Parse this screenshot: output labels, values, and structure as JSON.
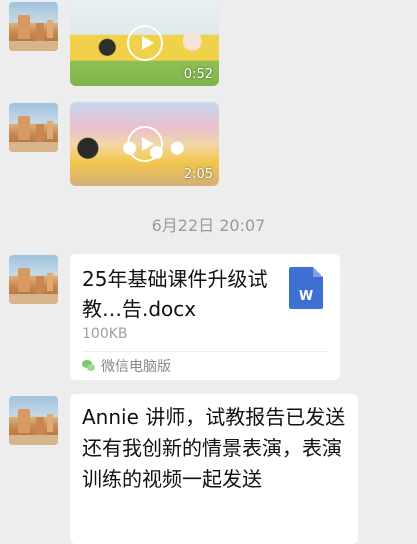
{
  "messages": {
    "video1": {
      "duration": "0:52"
    },
    "video2": {
      "duration": "2:05"
    },
    "timestamp": "6月22日 20:07",
    "file": {
      "name": "25年基础课件升级试教…告.docx",
      "size": "100KB",
      "icon_letter": "W",
      "source": "微信电脑版"
    },
    "text": "Annie 讲师，试教报告已发送还有我创新的情景表演，表演训练的视频一起发送"
  },
  "icons": [
    "avatar",
    "play-icon",
    "word-doc-icon",
    "wechat-icon"
  ]
}
